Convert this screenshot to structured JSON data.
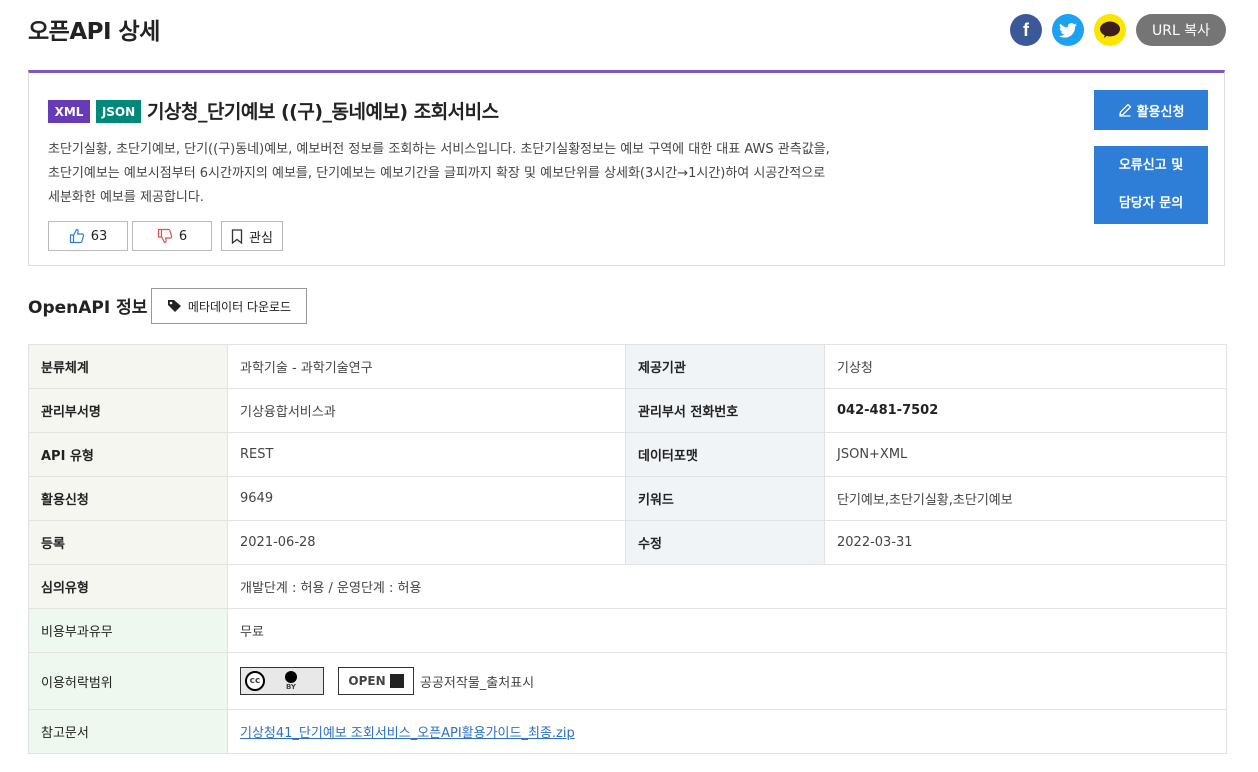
{
  "header": {
    "title": "오픈API 상세",
    "share": {
      "facebook_icon": "facebook-icon",
      "twitter_icon": "twitter-icon",
      "kakao_icon": "kakaotalk-icon",
      "kakao_text": "TALK",
      "url_copy_label": "URL 복사"
    }
  },
  "api": {
    "badges": [
      "XML",
      "JSON"
    ],
    "title": "기상청_단기예보 ((구)_동네예보) 조회서비스",
    "description_lines": [
      "초단기실황, 초단기예보, 단기((구)동네)예보, 예보버전 정보를 조회하는 서비스입니다. 초단기실황정보는 예보 구역에 대한 대표 AWS 관측값을,",
      "초단기예보는 예보시점부터 6시간까지의 예보를, 단기예보는 예보기간을 글피까지 확장 및 예보단위를 상세화(3시간→1시간)하여 시공간적으로",
      "세분화한 예보를 제공합니다."
    ],
    "likes": "63",
    "dislikes": "6",
    "favorite_label": "관심",
    "apply_label": "활용신청",
    "report_line1": "오류신고 및",
    "report_line2": "담당자 문의"
  },
  "section": {
    "title": "OpenAPI 정보",
    "metadata_download_label": "메타데이터 다운로드"
  },
  "info": {
    "rows": [
      {
        "l1": "분류체계",
        "v1": "과학기술 - 과학기술연구",
        "l2": "제공기관",
        "v2": "기상청"
      },
      {
        "l1": "관리부서명",
        "v1": "기상융합서비스과",
        "l2": "관리부서 전화번호",
        "v2": "042-481-7502"
      },
      {
        "l1": "API 유형",
        "v1": "REST",
        "l2": "데이터포맷",
        "v2": "JSON+XML"
      },
      {
        "l1": "활용신청",
        "v1": "9649",
        "l2": "키워드",
        "v2": "단기예보,초단기실황,초단기예보"
      },
      {
        "l1": "등록",
        "v1": "2021-06-28",
        "l2": "수정",
        "v2": "2022-03-31"
      }
    ],
    "review_label": "심의유형",
    "review_value": "개발단계 : 허용 / 운영단계 : 허용",
    "fee_label": "비용부과유무",
    "fee_value": "무료",
    "license_label": "이용허락범위",
    "license_cc_text": "cc",
    "license_by_text": "BY",
    "license_open_text": "OPEN",
    "license_value": "공공저작물_출처표시",
    "ref_label": "참고문서",
    "ref_link": "기상청41_단기예보 조회서비스_오픈API활용가이드_최종.zip"
  },
  "colors": {
    "accent_purple": "#7e57c2",
    "xml_badge": "#673ab7",
    "json_badge": "#00897b",
    "primary_button": "#2e7dd7",
    "url_button": "#757575"
  }
}
